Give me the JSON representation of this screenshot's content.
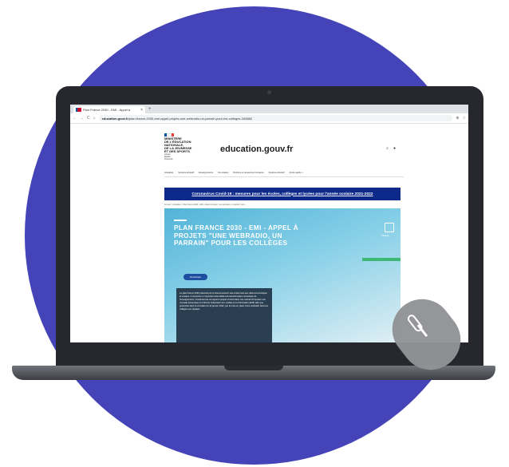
{
  "browser": {
    "tab_title": "Plan France 2030 - EMI - Appel à",
    "tab_close": "×",
    "new_tab": "+",
    "back": "←",
    "forward": "→",
    "reload": "C",
    "home": "⌂",
    "url_domain": "education.gouv.fr",
    "url_path": "/plan-france-2030-emi-appel-projets-une-webradio-un-parrain-pour-les-colleges-345882",
    "zoom": "⊕",
    "star": "☆"
  },
  "site": {
    "ministry": "MINISTÈRE\nDE L'ÉDUCATION\nNATIONALE,\nDE LA JEUNESSE\nET DES SPORTS",
    "motto": "Liberté\nÉgalité\nFraternité",
    "domain_title": "education.gouv.fr",
    "search_icon": "⌕",
    "menu_icon": "●",
    "flag_colors": [
      "#0055a4",
      "#ffffff",
      "#ef4135"
    ]
  },
  "nav": {
    "items": [
      "Actualités",
      "Système éducatif",
      "Enseignements",
      "Vie scolaire",
      "Réforme et ressources humaines",
      "Système éducatif",
      "Accès rapide ∨"
    ]
  },
  "alert": {
    "text": "Coronavirus Covid-19 : mesures pour les écoles, collèges et lycées pour l'année scolaire 2021-2022"
  },
  "breadcrumb": "Accueil > Actualités > Plan France 2030 - EMI - Appel à projets \"une webradio, un parrain\" pour...",
  "hero": {
    "title": "PLAN FRANCE 2030 - EMI - APPEL À PROJETS \"UNE WEBRADIO, UN PARRAIN\" POUR LES COLLÈGES",
    "share_label": "Partager",
    "tag": "Numérique",
    "body": "Le plan France 2030 présenté par le Gouvernement vise à faire face aux défis économiques et sociaux. Il comporte un important volet dédié à la transformation numérique de l'enseignement. Combinant de cet appel à projets s'inscrit dans une volonté d'impulser une nouvelle dynamique et renforcer l'éducation aux médias et à l'information (EMI) telle que présentée dans la circulaire du 24 janvier 2022, par la mise en place d'une webradio dans les collèges non équipés."
  },
  "colors": {
    "background_circle": "#4543b8",
    "laptop_body": "#26282e",
    "banner": "#0d2a8a",
    "hero_accent": "#3cb874",
    "mouse_overlay": "#919396"
  },
  "overlay": {
    "icon": "mouse-icon"
  }
}
